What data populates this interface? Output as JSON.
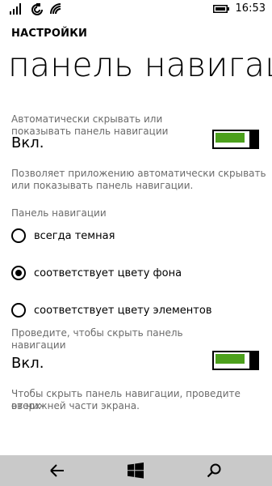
{
  "status": {
    "time": "16:53",
    "icons": [
      "signal-icon",
      "sync-icon",
      "wifi-icon",
      "battery-icon"
    ]
  },
  "header": {
    "section": "НАСТРОЙКИ",
    "title": "панель навигац"
  },
  "auto_hide": {
    "label_line1": "Автоматически скрывать или",
    "label_line2": "показывать панель навигации",
    "value": "Вкл.",
    "on": true,
    "desc_line1": "Позволяет приложению автоматически скрывать",
    "desc_line2": "или показывать панель навигации."
  },
  "nav_color": {
    "label": "Панель навигации",
    "options": [
      {
        "label": "всегда темная",
        "selected": false
      },
      {
        "label": "соответствует цвету фона",
        "selected": true
      },
      {
        "label": "соответствует цвету элементов",
        "selected": false
      }
    ]
  },
  "swipe_hide": {
    "label_line1": "Проведите, чтобы скрыть панель",
    "label_line2": "навигации",
    "value": "Вкл.",
    "on": true,
    "desc_line1": "Чтобы скрыть панель навигации, проведите вверх",
    "desc_line2": "от нижней части экрана."
  },
  "navbar": {
    "buttons": [
      "back-arrow-icon",
      "windows-logo-icon",
      "search-icon"
    ]
  },
  "colors": {
    "accent": "#4ca01c",
    "navbar_bg": "#c9c9c9"
  }
}
